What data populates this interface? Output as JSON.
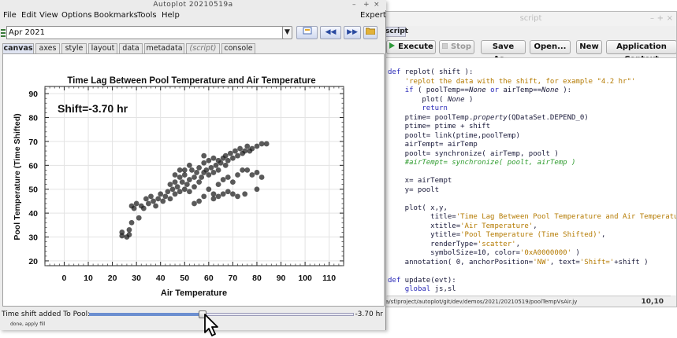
{
  "script_window": {
    "title": "script",
    "tab_label": "script",
    "toolbar": {
      "execute": "Execute",
      "stop": "Stop",
      "save_as": "Save As...",
      "open": "Open...",
      "new": "New",
      "app_context": "Application Context"
    },
    "status_path": "a/sf/project/autoplot/git/dev/demos/2021/20210519/poolTempVsAir.jy",
    "cursor_pos": "10,10"
  },
  "window": {
    "title": "Autoplot 20210519a"
  },
  "menu": [
    "File",
    "Edit",
    "View",
    "Options",
    "Bookmarks",
    "Tools",
    "Help"
  ],
  "menu_right": "Expert",
  "uri": {
    "value": "Apr 2021"
  },
  "tabs": [
    "canvas",
    "axes",
    "style",
    "layout",
    "data",
    "metadata",
    "(script)",
    "console"
  ],
  "active_tab": "canvas",
  "plot": {
    "annotation": "Shift=-3.70 hr"
  },
  "slider": {
    "label": "Time shift added To Pool:",
    "value_text": "-3.70 hr",
    "fraction": 0.43
  },
  "status": {
    "text": "done, apply fill"
  },
  "colors": {
    "points": "#1a1a1a",
    "accent": "#6c8fd0",
    "keyword": "#2a2ab8",
    "string": "#b47a00",
    "comment": "#2f9c2f"
  },
  "chart_data": {
    "type": "scatter",
    "title": "Time Lag Between Pool Temperature and Air Temperature",
    "xlabel": "Air Temperature",
    "ylabel": "Pool Temperature (Time Shifted)",
    "xlim": [
      -8,
      116
    ],
    "ylim": [
      18,
      93
    ],
    "x_ticks": [
      0,
      10,
      20,
      30,
      40,
      50,
      60,
      70,
      80,
      90,
      100,
      110
    ],
    "y_ticks": [
      20,
      30,
      40,
      50,
      60,
      70,
      80,
      90
    ],
    "grid": true,
    "legend": "none",
    "series": [
      {
        "points": [
          [
            24,
            32
          ],
          [
            24,
            30.5
          ],
          [
            27,
            31
          ],
          [
            26,
            30
          ],
          [
            27,
            33
          ],
          [
            28,
            36
          ],
          [
            29,
            42
          ],
          [
            28,
            43
          ],
          [
            30,
            44
          ],
          [
            31,
            38
          ],
          [
            32,
            43
          ],
          [
            33,
            42
          ],
          [
            34,
            46
          ],
          [
            35,
            44
          ],
          [
            36,
            47
          ],
          [
            37,
            45
          ],
          [
            38,
            43
          ],
          [
            39,
            46
          ],
          [
            40,
            48
          ],
          [
            41,
            45
          ],
          [
            42,
            47
          ],
          [
            43,
            49
          ],
          [
            44,
            52
          ],
          [
            44,
            46
          ],
          [
            45,
            50
          ],
          [
            46,
            48
          ],
          [
            46,
            53
          ],
          [
            47,
            51
          ],
          [
            48,
            49
          ],
          [
            48,
            55
          ],
          [
            49,
            53
          ],
          [
            50,
            50
          ],
          [
            50,
            56
          ],
          [
            51,
            52
          ],
          [
            52,
            54
          ],
          [
            52,
            49
          ],
          [
            53,
            58
          ],
          [
            54,
            55
          ],
          [
            54,
            51
          ],
          [
            55,
            57
          ],
          [
            56,
            53
          ],
          [
            56,
            59
          ],
          [
            57,
            55
          ],
          [
            58,
            57
          ],
          [
            58,
            61
          ],
          [
            59,
            58
          ],
          [
            60,
            56
          ],
          [
            60,
            62
          ],
          [
            61,
            59
          ],
          [
            62,
            57
          ],
          [
            62,
            63
          ],
          [
            63,
            60
          ],
          [
            64,
            62
          ],
          [
            64,
            58
          ],
          [
            65,
            61
          ],
          [
            66,
            63
          ],
          [
            67,
            60
          ],
          [
            67,
            64
          ],
          [
            68,
            62
          ],
          [
            69,
            65
          ],
          [
            70,
            63
          ],
          [
            71,
            66
          ],
          [
            72,
            64
          ],
          [
            73,
            67
          ],
          [
            74,
            65
          ],
          [
            75,
            66
          ],
          [
            76,
            68
          ],
          [
            77,
            66
          ],
          [
            78,
            67
          ],
          [
            80,
            68
          ],
          [
            82,
            69
          ],
          [
            84,
            69
          ],
          [
            60,
            50
          ],
          [
            62,
            48
          ],
          [
            64,
            52
          ],
          [
            66,
            54
          ],
          [
            68,
            55
          ],
          [
            70,
            53
          ],
          [
            72,
            56
          ],
          [
            74,
            58
          ],
          [
            76,
            58
          ],
          [
            78,
            56
          ],
          [
            80,
            57
          ],
          [
            82,
            55
          ],
          [
            64,
            47
          ],
          [
            68,
            49
          ],
          [
            70,
            48
          ],
          [
            72,
            47
          ],
          [
            75,
            48
          ],
          [
            80,
            50
          ],
          [
            54,
            44
          ],
          [
            58,
            47
          ],
          [
            62,
            46
          ],
          [
            66,
            48
          ],
          [
            56,
            45
          ],
          [
            46,
            56
          ],
          [
            50,
            58
          ],
          [
            52,
            60
          ],
          [
            48,
            58
          ],
          [
            58,
            64
          ]
        ]
      }
    ]
  }
}
